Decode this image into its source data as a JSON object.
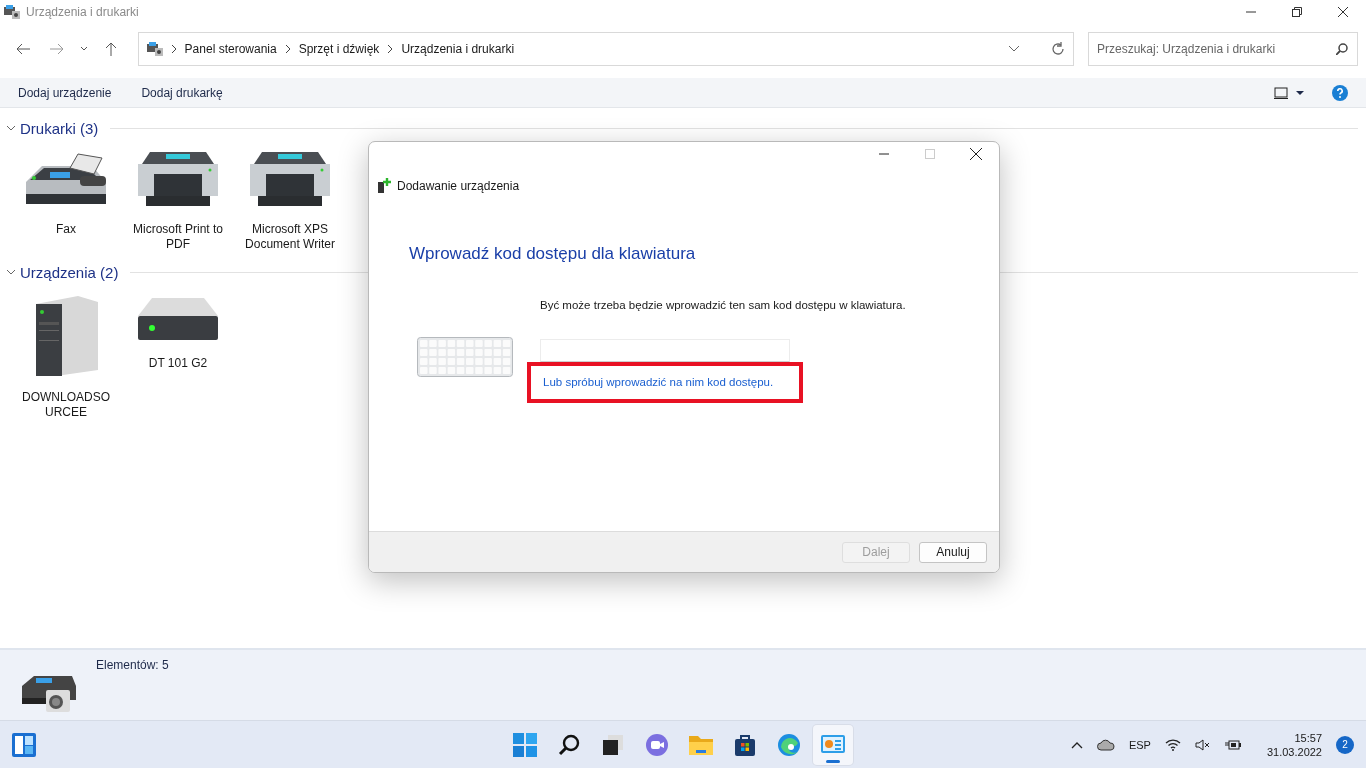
{
  "window": {
    "title": "Urządzenia i drukarki"
  },
  "breadcrumb": [
    "Panel sterowania",
    "Sprzęt i dźwięk",
    "Urządzenia i drukarki"
  ],
  "search": {
    "placeholder": "Przeszukaj: Urządzenia i drukarki"
  },
  "commands": [
    "Dodaj urządzenie",
    "Dodaj drukarkę"
  ],
  "groups": [
    {
      "title": "Drukarki (3)",
      "expanded": true,
      "items": [
        {
          "label": "Fax",
          "kind": "fax"
        },
        {
          "label": "Microsoft Print to PDF",
          "kind": "printer"
        },
        {
          "label": "Microsoft XPS Document Writer",
          "kind": "printer"
        }
      ]
    },
    {
      "title": "Urządzenia (2)",
      "expanded": true,
      "items": [
        {
          "label": "DOWNLOADSOURCEE",
          "kind": "tower"
        },
        {
          "label": "DT 101 G2",
          "kind": "drive"
        }
      ]
    }
  ],
  "details": {
    "summary": "Elementów: 5"
  },
  "dialog": {
    "title": "Dodawanie urządzenia",
    "heading": "Wprowadź kod dostępu dla klawiatura",
    "message": "Być może trzeba będzie wprowadzić ten sam kod dostępu w klawiatura.",
    "link": "Lub spróbuj wprowadzić na nim kod dostępu.",
    "highlighted": true,
    "buttons": [
      {
        "label": "Dalej",
        "disabled": true
      },
      {
        "label": "Anuluj",
        "disabled": false
      }
    ]
  },
  "taskbar": {
    "apps": [
      {
        "kind": "start",
        "selected": false
      },
      {
        "kind": "search",
        "selected": false
      },
      {
        "kind": "taskview",
        "selected": false
      },
      {
        "kind": "chat",
        "selected": false
      },
      {
        "kind": "folder",
        "selected": false
      },
      {
        "kind": "store",
        "selected": false
      },
      {
        "kind": "edge",
        "selected": false
      },
      {
        "kind": "control-panel",
        "selected": true
      }
    ],
    "language": "ESP",
    "time": "15:57",
    "date": "31.03.2022",
    "notifications": "2"
  }
}
